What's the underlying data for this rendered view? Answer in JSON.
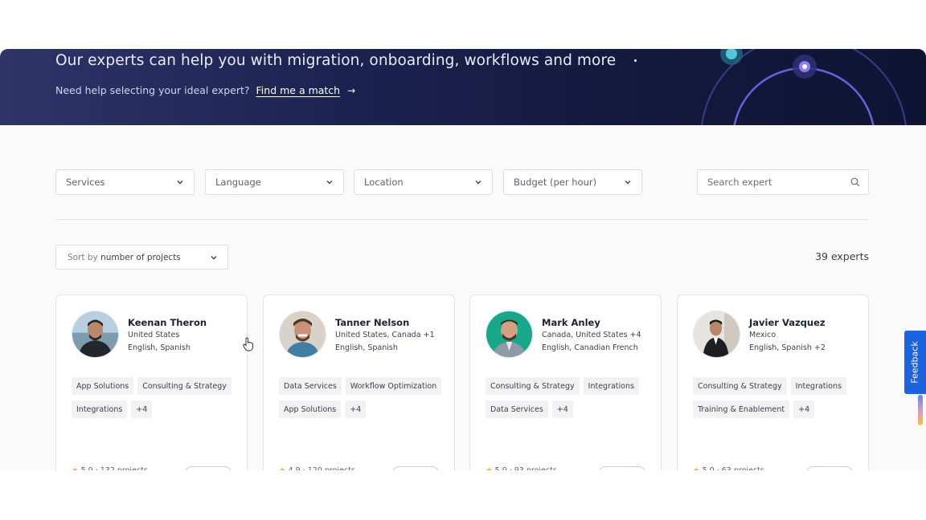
{
  "hero": {
    "title": "Our experts can help you with migration, onboarding, workflows and more",
    "subtitle": "Need help selecting your ideal expert?",
    "link": "Find me a match",
    "link_arrow": "→"
  },
  "filters": {
    "services": "Services",
    "language": "Language",
    "location": "Location",
    "budget": "Budget (per hour)",
    "search_placeholder": "Search expert"
  },
  "sort": {
    "prefix": "Sort by",
    "value": "number of projects"
  },
  "results_count": "39 experts",
  "experts": [
    {
      "name": "Keenan Theron",
      "location": "United States",
      "languages": "English, Spanish",
      "tags": [
        "App Solutions",
        "Consulting & Strategy",
        "Integrations",
        "+4"
      ],
      "rating": "5.0",
      "projects": "132 projects"
    },
    {
      "name": "Tanner Nelson",
      "location": "United States, Canada +1",
      "languages": "English, Spanish",
      "tags": [
        "Data Services",
        "Workflow Optimization",
        "App Solutions",
        "+4"
      ],
      "rating": "4.9",
      "projects": "120 projects"
    },
    {
      "name": "Mark Anley",
      "location": "Canada, United States +4",
      "languages": "English, Canadian French",
      "tags": [
        "Consulting & Strategy",
        "Integrations",
        "Data Services",
        "+4"
      ],
      "rating": "5.0",
      "projects": "93 projects"
    },
    {
      "name": "Javier Vazquez",
      "location": "Mexico",
      "languages": "English, Spanish +2",
      "tags": [
        "Consulting & Strategy",
        "Integrations",
        "Training & Enablement",
        "+4"
      ],
      "rating": "5.0",
      "projects": "63 projects"
    }
  ],
  "feedback": "Feedback",
  "colors": {
    "accent": "#1c63e0",
    "hero_bg": "#1d2352",
    "star": "#f2b21c"
  }
}
